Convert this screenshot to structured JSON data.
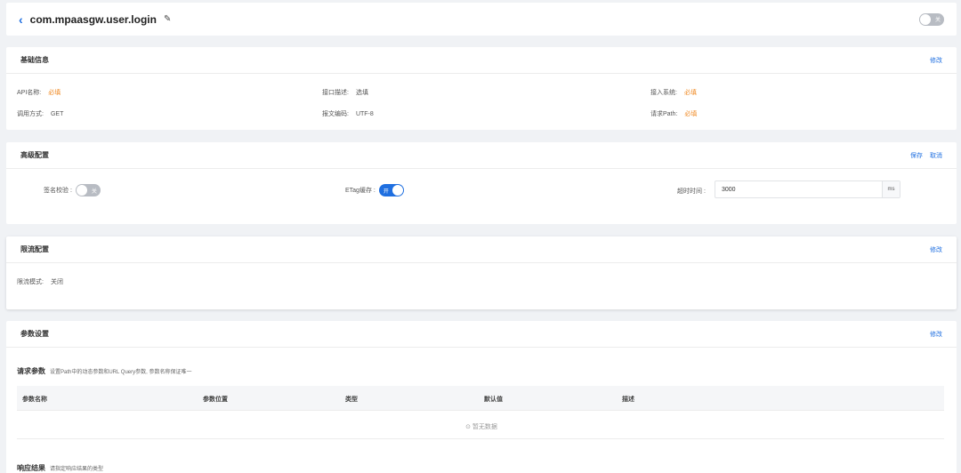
{
  "header": {
    "back_icon": "‹",
    "title": "com.mpaasgw.user.login",
    "edit_icon": "✎",
    "toggle_label": "关"
  },
  "basic": {
    "title": "基础信息",
    "edit_label": "修改",
    "fields": [
      {
        "label": "API名称:",
        "value": "必填",
        "required": true
      },
      {
        "label": "接口描述:",
        "value": "选填",
        "required": false
      },
      {
        "label": "接入系统:",
        "value": "必填",
        "required": true
      },
      {
        "label": "调用方式:",
        "value": "GET",
        "required": false
      },
      {
        "label": "报文编码:",
        "value": "UTF-8",
        "required": false
      },
      {
        "label": "请求Path:",
        "value": "必填",
        "required": true
      }
    ]
  },
  "advanced": {
    "title": "高级配置",
    "save_label": "保存",
    "cancel_label": "取消",
    "signature_label": "签名校验 :",
    "signature_toggle": "关",
    "etag_label": "ETag缓存 :",
    "etag_toggle": "开",
    "timeout_label": "超时时间 :",
    "timeout_value": "3000",
    "timeout_unit": "ms"
  },
  "limit": {
    "title": "限流配置",
    "edit_label": "修改",
    "mode_label": "限流模式:",
    "mode_value": "关闭"
  },
  "params": {
    "title": "参数设置",
    "edit_label": "修改",
    "request_title": "请求参数",
    "request_hint": "设置Path中的动态参数和URL Query参数, 参数名称保证唯一",
    "columns": [
      "参数名称",
      "参数位置",
      "类型",
      "默认值",
      "描述"
    ],
    "empty_text": "⊙ 暂无数据",
    "response_title": "响应结果",
    "response_hint": "请指定响应结果的类型"
  },
  "colors": {
    "accent": "#1f6fe0",
    "required": "#f08a24",
    "toggle_off": "#b8bcc3"
  }
}
